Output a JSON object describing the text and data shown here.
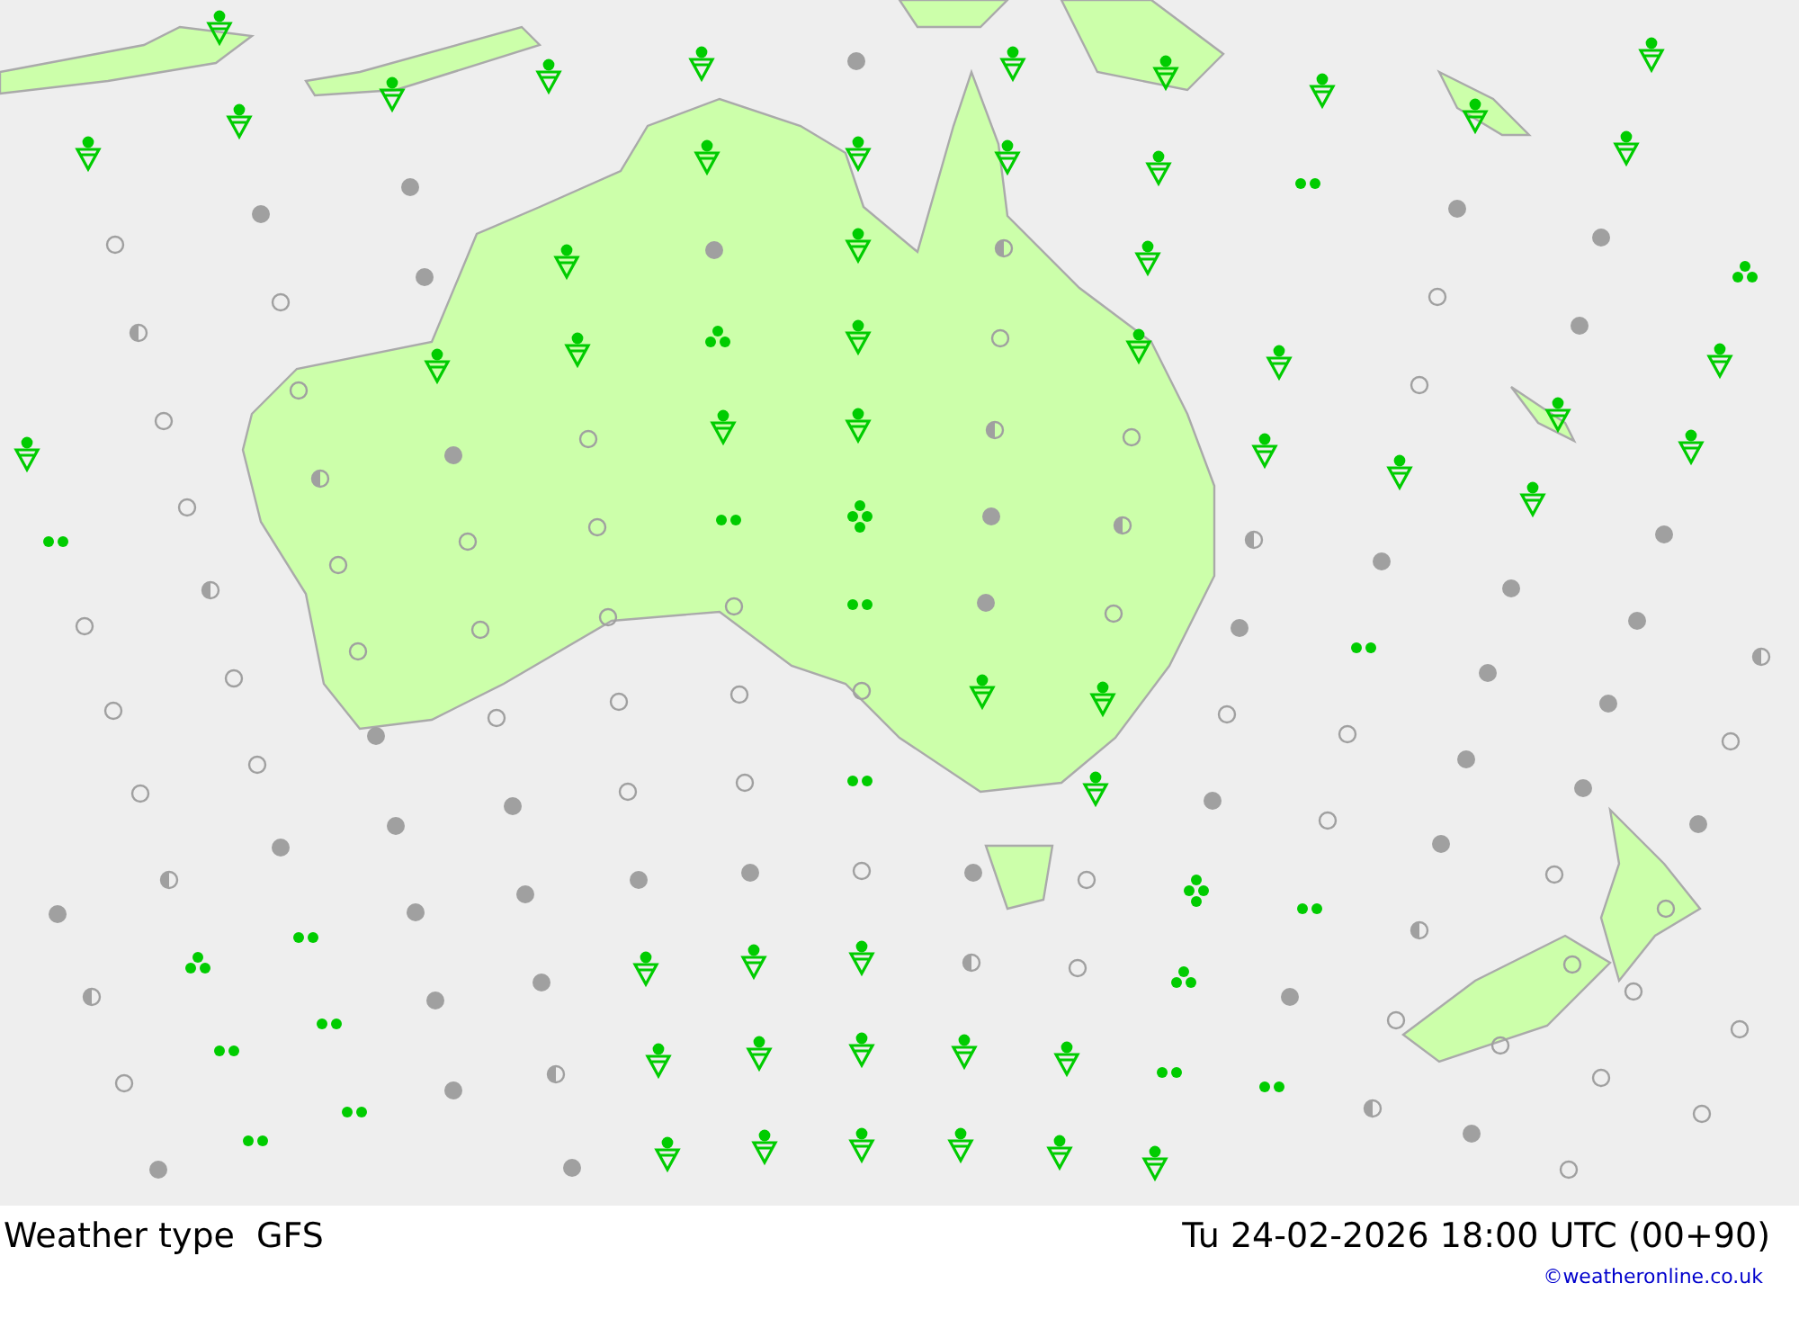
{
  "map": {
    "model_label": "Weather type  GFS",
    "valid_time": "Tu 24-02-2026 18:00 UTC (00+90)",
    "credit": "©weatheronline.co.uk"
  }
}
